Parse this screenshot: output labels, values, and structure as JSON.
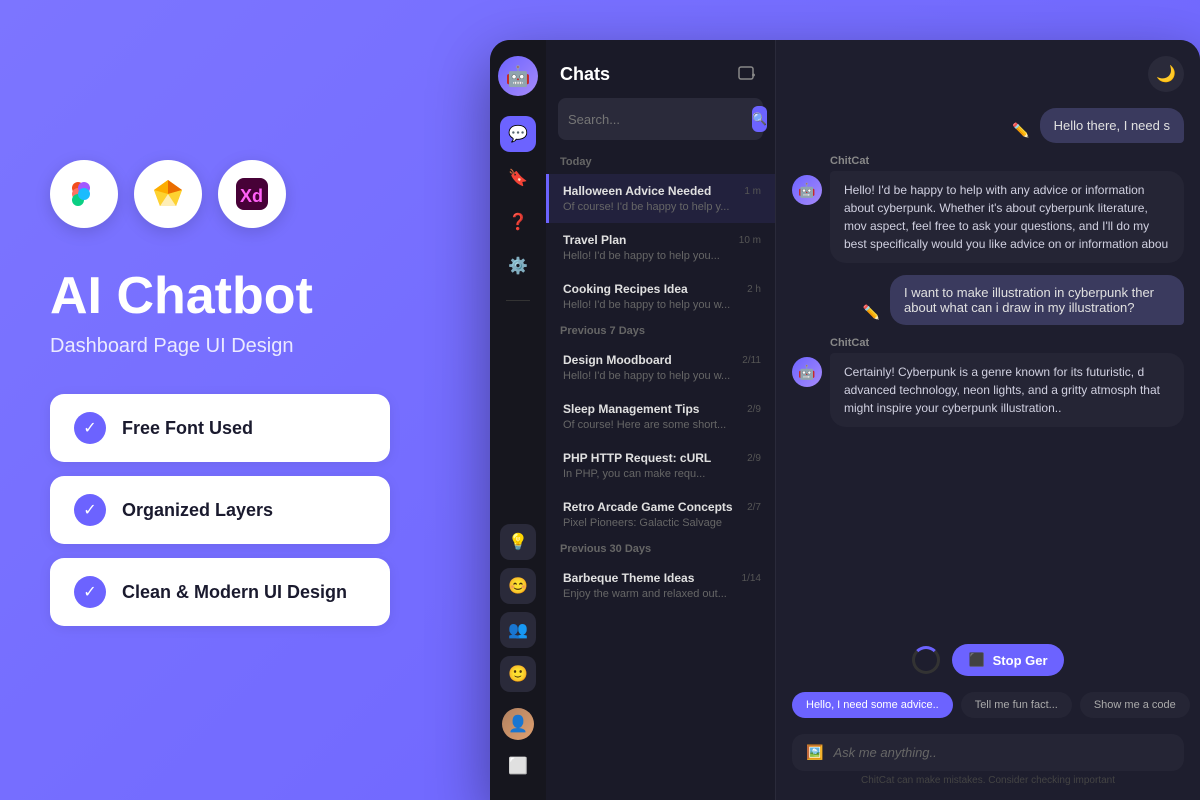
{
  "left": {
    "tool_icons": [
      {
        "name": "figma",
        "emoji": "🎨",
        "bg": "#f5f5f5"
      },
      {
        "name": "sketch",
        "emoji": "💎",
        "bg": "#f5f5f5"
      },
      {
        "name": "xd",
        "emoji": "🟣",
        "bg": "#f5f5f5"
      }
    ],
    "title": "AI Chatbot",
    "subtitle": "Dashboard Page UI Design",
    "features": [
      {
        "label": "Free Font Used"
      },
      {
        "label": "Organized Layers"
      },
      {
        "label": "Clean & Modern UI Design"
      }
    ]
  },
  "app": {
    "sidebar_icons": [
      "💬",
      "🔖",
      "❓",
      "⚙️"
    ],
    "chat_list": {
      "title": "Chats",
      "search_placeholder": "Search...",
      "today_label": "Today",
      "prev7_label": "Previous 7 Days",
      "prev30_label": "Previous 30 Days",
      "chats": [
        {
          "name": "Halloween Advice Needed",
          "preview": "Of course! I'd be happy to help y...",
          "time": "1 m",
          "active": true
        },
        {
          "name": "Travel Plan",
          "preview": "Hello! I'd be happy to help you...",
          "time": "10 m",
          "active": false
        },
        {
          "name": "Cooking Recipes Idea",
          "preview": "Hello! I'd be happy to help you w...",
          "time": "2 h",
          "active": false
        },
        {
          "name": "Design Moodboard",
          "preview": "Hello! I'd be happy to help you w...",
          "time": "2/11",
          "active": false,
          "section": "prev7"
        },
        {
          "name": "Sleep Management Tips",
          "preview": "Of course! Here are some short...",
          "time": "2/9",
          "active": false
        },
        {
          "name": "PHP HTTP Request: cURL",
          "preview": "In PHP, you can make requ...",
          "time": "2/9",
          "active": false
        },
        {
          "name": "Retro Arcade Game Concepts",
          "preview": "Pixel Pioneers: Galactic Salvage",
          "time": "2/7",
          "active": false
        },
        {
          "name": "Barbeque Theme Ideas",
          "preview": "Enjoy the warm and relaxed out...",
          "time": "1/14",
          "active": false,
          "section": "prev30"
        }
      ]
    },
    "messages": [
      {
        "type": "user",
        "text": "Hello there, I need s"
      },
      {
        "type": "bot",
        "sender": "ChitCat",
        "text": "Hello! I'd be happy to help with any advice or information about cyberpunk. Whether it's about cyberpunk literature, mov aspect, feel free to ask your questions, and I'll do my best specifically would you like advice on or information abou"
      },
      {
        "type": "user",
        "text": "I want to make illustration in cyberpunk ther about what can i draw in my illustration?"
      },
      {
        "type": "bot",
        "sender": "ChitCat",
        "text": "Certainly! Cyberpunk is a genre known for its futuristic, d advanced technology, neon lights, and a gritty atmosph that might inspire your cyberpunk illustration.."
      }
    ],
    "stop_gen_label": "Stop Ger",
    "quick_actions": [
      {
        "label": "Hello, I need some advice..",
        "purple": true
      },
      {
        "label": "Tell me fun fact..."
      },
      {
        "label": "Show me a code"
      }
    ],
    "input_placeholder": "Ask me anything..",
    "disclaimer": "ChitCat can make mistakes. Consider checking important"
  }
}
